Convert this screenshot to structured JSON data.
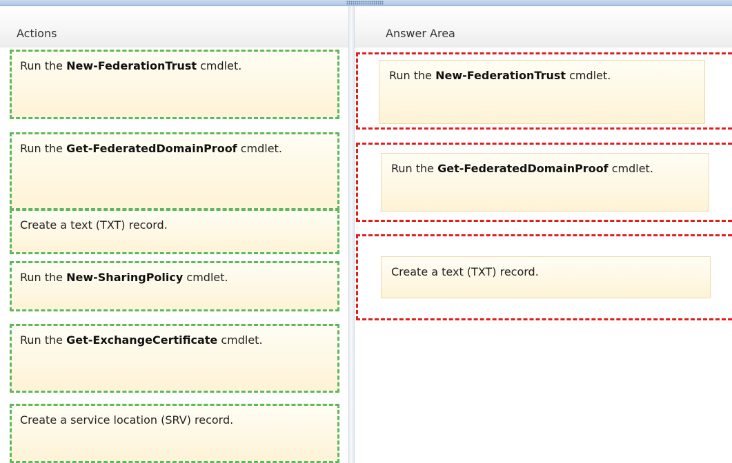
{
  "panes": {
    "left_title": "Actions",
    "right_title": "Answer Area"
  },
  "actions": [
    {
      "pre": "Run the ",
      "bold": "New-FederationTrust",
      "post": " cmdlet."
    },
    {
      "pre": "Run the ",
      "bold": "Get-FederatedDomainProof",
      "post": " cmdlet."
    },
    {
      "pre": "Create a text (TXT) record.",
      "bold": "",
      "post": ""
    },
    {
      "pre": "Run the ",
      "bold": "New-SharingPolicy",
      "post": " cmdlet."
    },
    {
      "pre": "Run the ",
      "bold": "Get-ExchangeCertificate",
      "post": " cmdlet."
    },
    {
      "pre": "Create a service location (SRV) record.",
      "bold": "",
      "post": ""
    }
  ],
  "answers": [
    {
      "pre": "Run the ",
      "bold": "New-FederationTrust",
      "post": " cmdlet."
    },
    {
      "pre": "Run the ",
      "bold": "Get-FederatedDomainProof",
      "post": " cmdlet."
    },
    {
      "pre": "Create a text (TXT) record.",
      "bold": "",
      "post": ""
    }
  ],
  "colors": {
    "action_border": "#5cb85c",
    "slot_border": "#e31b1b",
    "item_background": "#fdf3d6"
  }
}
